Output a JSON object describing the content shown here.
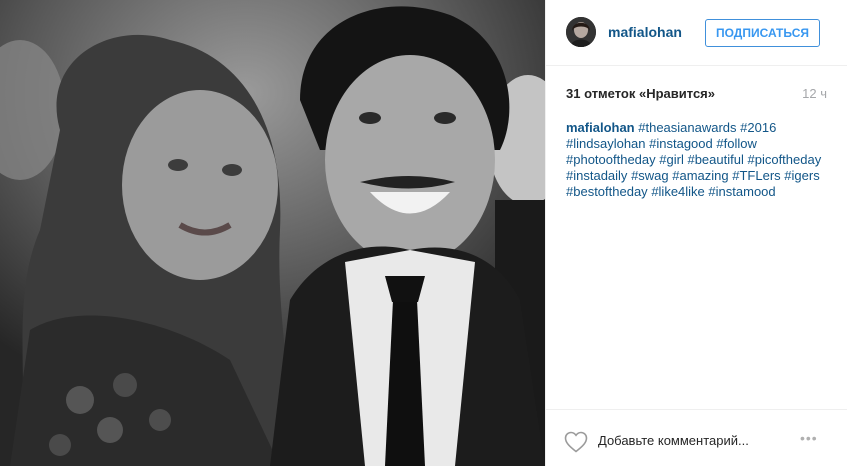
{
  "header": {
    "username": "mafialohan",
    "follow_label": "ПОДПИСАТЬСЯ"
  },
  "stats": {
    "likes": "31 отметок «Нравится»",
    "time": "12 ч"
  },
  "caption": {
    "author": "mafialohan",
    "tags": [
      "#theasianawards",
      "#2016",
      "#lindsaylohan",
      "#instagood",
      "#follow",
      "#photooftheday",
      "#girl",
      "#beautiful",
      "#picoftheday",
      "#instadaily",
      "#swag",
      "#amazing",
      "#TFLers",
      "#igers",
      "#bestoftheday",
      "#like4like",
      "#instamood"
    ]
  },
  "comment": {
    "placeholder": "Добавьте комментарий...",
    "more_icon": "ellipsis-icon"
  },
  "colors": {
    "link": "#125688",
    "follow_blue": "#3897f0",
    "muted": "#a5a7aa"
  }
}
